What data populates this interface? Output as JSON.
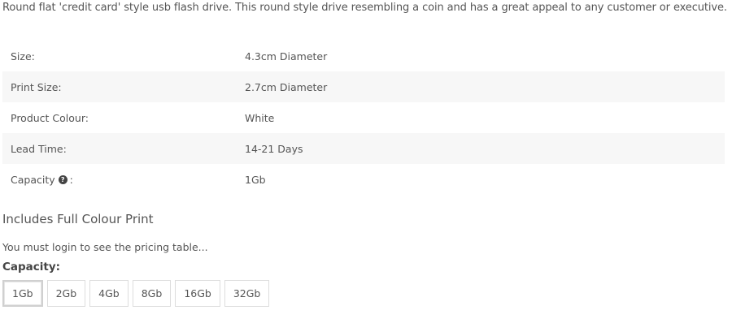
{
  "intro": "Round flat 'credit card' style usb flash drive. This round style drive resembling a coin and has a great appeal to any customer or executive.",
  "specs": [
    {
      "label": "Size:",
      "value": "4.3cm Diameter"
    },
    {
      "label": "Print Size:",
      "value": "2.7cm Diameter"
    },
    {
      "label": "Product Colour:",
      "value": "White"
    },
    {
      "label": "Lead Time:",
      "value": "14-21 Days"
    },
    {
      "label": "Capacity",
      "value": "1Gb",
      "icon": "question-circle-icon",
      "suffix": ":"
    }
  ],
  "includes_text": "Includes Full Colour Print",
  "login_note": "You must login to see the pricing table...",
  "capacity": {
    "heading": "Capacity:",
    "options": [
      "1Gb",
      "2Gb",
      "4Gb",
      "8Gb",
      "16Gb",
      "32Gb"
    ],
    "selected": "1Gb"
  },
  "colors": {
    "text": "#555555",
    "row_alt": "#f7f7f7",
    "border": "#dddddd"
  }
}
